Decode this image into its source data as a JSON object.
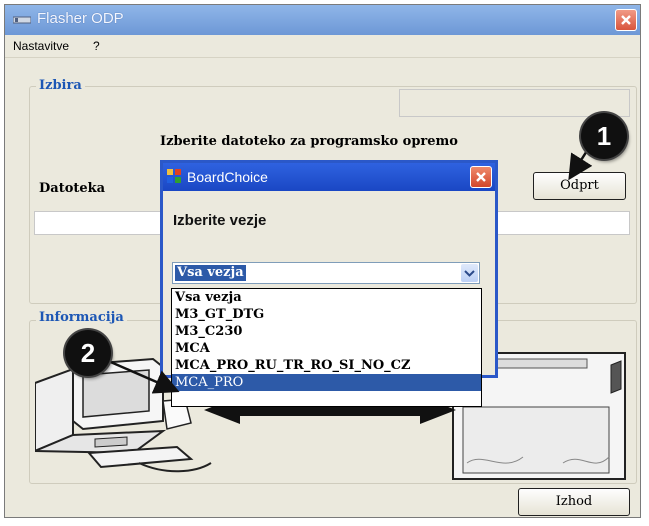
{
  "window": {
    "title": "Flasher ODP"
  },
  "menu": {
    "items": [
      "Nastavitve",
      "?"
    ]
  },
  "izbira": {
    "group_title": "Izbira",
    "prompt": "Izberite datoteko za programsko opremo",
    "file_label": "Datoteka",
    "open_button": "Odprt",
    "file_path_value": ""
  },
  "informacija": {
    "group_title": "Informacija"
  },
  "exit_button": "Izhod",
  "dialog": {
    "title": "BoardChoice",
    "label": "Izberite vezje",
    "combo_value": "Vsa vezja",
    "options": [
      "Vsa vezja",
      "M3_GT_DTG",
      "M3_C230",
      "MCA",
      "MCA_PRO_RU_TR_RO_SI_NO_CZ",
      "MCA_PRO"
    ],
    "selected_option": "MCA_PRO"
  },
  "callouts": {
    "one": "1",
    "two": "2"
  },
  "colors": {
    "group_title": "#1d57b5",
    "dialog_title": "#2451d0",
    "selection": "#2d5aa8"
  }
}
